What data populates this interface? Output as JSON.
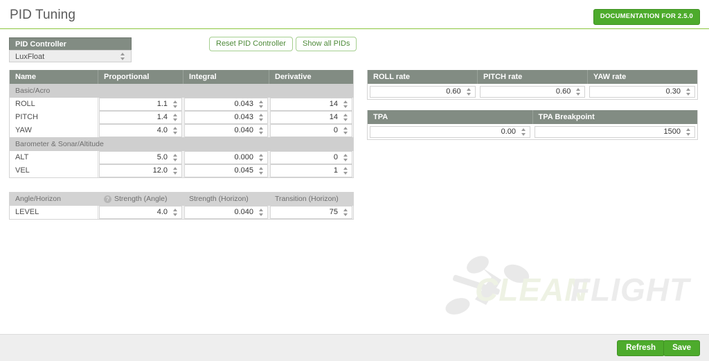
{
  "header": {
    "title": "PID Tuning",
    "documentation_button": "DOCUMENTATION FOR 2.5.0",
    "accent_green": "#8cc63f",
    "button_green": "#4dab2c"
  },
  "pid_controller": {
    "label": "PID Controller",
    "selected": "LuxFloat",
    "spinner_icon": "updown-spinner-icon"
  },
  "toolbar": {
    "reset_label": "Reset PID Controller",
    "show_all_label": "Show all PIDs"
  },
  "pid_table": {
    "columns": [
      "Name",
      "Proportional",
      "Integral",
      "Derivative"
    ],
    "groups": [
      {
        "title": "Basic/Acro",
        "rows": [
          {
            "name": "ROLL",
            "proportional": "1.1",
            "integral": "0.043",
            "derivative": "14"
          },
          {
            "name": "PITCH",
            "proportional": "1.4",
            "integral": "0.043",
            "derivative": "14"
          },
          {
            "name": "YAW",
            "proportional": "4.0",
            "integral": "0.040",
            "derivative": "0"
          }
        ]
      },
      {
        "title": "Barometer & Sonar/Altitude",
        "rows": [
          {
            "name": "ALT",
            "proportional": "5.0",
            "integral": "0.000",
            "derivative": "0"
          },
          {
            "name": "VEL",
            "proportional": "12.0",
            "integral": "0.045",
            "derivative": "1"
          }
        ]
      }
    ]
  },
  "angle_table": {
    "group_title": "Angle/Horizon",
    "help_icon": "question-mark-icon",
    "columns": [
      "Strength (Angle)",
      "Strength (Horizon)",
      "Transition (Horizon)"
    ],
    "rows": [
      {
        "name": "LEVEL",
        "strength_angle": "4.0",
        "strength_horizon": "0.040",
        "transition_horizon": "75"
      }
    ]
  },
  "rates": {
    "columns": [
      "ROLL rate",
      "PITCH rate",
      "YAW rate"
    ],
    "values": [
      "0.60",
      "0.60",
      "0.30"
    ]
  },
  "tpa": {
    "columns": [
      "TPA",
      "TPA Breakpoint"
    ],
    "values": [
      "0.00",
      "1500"
    ]
  },
  "footer": {
    "refresh_label": "Refresh",
    "save_label": "Save"
  },
  "watermark": {
    "text": "CLEANFLIGHT"
  }
}
